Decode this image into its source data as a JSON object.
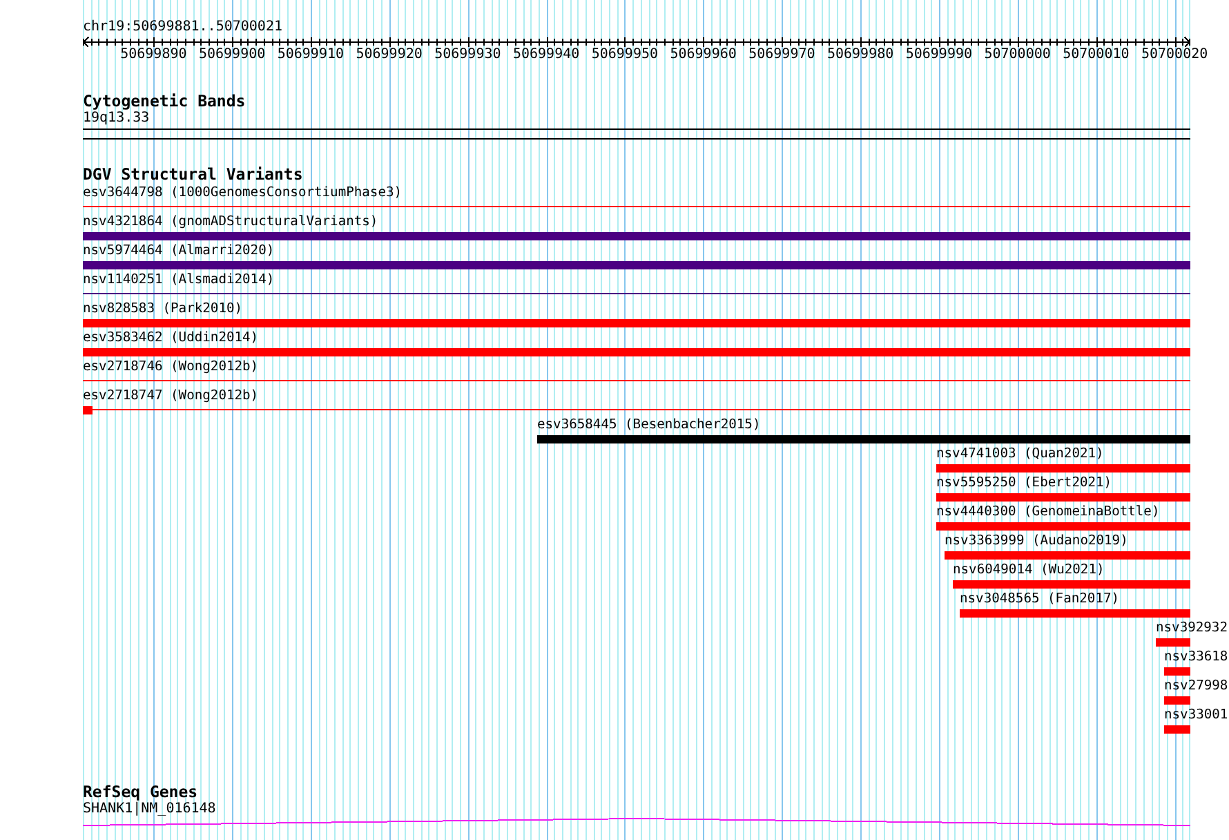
{
  "ruler": {
    "location": "chr19:50699881..50700021",
    "ticks": [
      "50699890",
      "50699900",
      "50699910",
      "50699920",
      "50699930",
      "50699940",
      "50699950",
      "50699960",
      "50699970",
      "50699980",
      "50699990",
      "50700000",
      "50700010",
      "50700020"
    ]
  },
  "tracks": [
    {
      "kind": "cytoband",
      "title": "Cytogenetic Bands",
      "bands": [
        {
          "label": "19q13.33"
        }
      ]
    },
    {
      "kind": "variants",
      "title": "DGV Structural Variants",
      "features": [
        {
          "label": "esv3644798 (1000GenomesConsortiumPhase3)",
          "kind": "thin",
          "color": "#ff0000"
        },
        {
          "label": "nsv4321864 (gnomADStructuralVariants)",
          "kind": "thick",
          "color": "#4b0082"
        },
        {
          "label": "nsv5974464 (Almarri2020)",
          "kind": "thick",
          "color": "#4b0082"
        },
        {
          "label": "nsv1140251 (Alsmadi2014)",
          "kind": "thin",
          "color": "#4b0082"
        },
        {
          "label": "nsv828583 (Park2010)",
          "kind": "thick",
          "color": "#ff0000"
        },
        {
          "label": "esv3583462 (Uddin2014)",
          "kind": "thick",
          "color": "#ff0000"
        },
        {
          "label": "esv2718746 (Wong2012b)",
          "kind": "thin",
          "color": "#ff0000"
        },
        {
          "label": "esv2718747 (Wong2012b)",
          "kind": "thin_start_block",
          "color": "#ff0000"
        },
        {
          "label": "esv3658445 (Besenbacher2015)",
          "kind": "thick",
          "color": "#000000"
        },
        {
          "label": "nsv4741003 (Quan2021)",
          "kind": "thick",
          "color": "#ff0000"
        },
        {
          "label": "nsv5595250 (Ebert2021)",
          "kind": "thick",
          "color": "#ff0000"
        },
        {
          "label": "nsv4440300 (GenomeinaBottle)",
          "kind": "thick",
          "color": "#ff0000"
        },
        {
          "label": "nsv3363999 (Audano2019)",
          "kind": "thick",
          "color": "#ff0000"
        },
        {
          "label": "nsv6049014 (Wu2021)",
          "kind": "thick",
          "color": "#ff0000"
        },
        {
          "label": "nsv3048565 (Fan2017)",
          "kind": "thick",
          "color": "#ff0000"
        },
        {
          "label": "nsv392932",
          "kind": "thick",
          "color": "#ff0000"
        },
        {
          "label": "nsv33618",
          "kind": "thick",
          "color": "#ff0000"
        },
        {
          "label": "nsv27998",
          "kind": "thick",
          "color": "#ff0000"
        },
        {
          "label": "nsv33001",
          "kind": "thick",
          "color": "#ff0000"
        }
      ]
    },
    {
      "kind": "genes",
      "title": "RefSeq Genes",
      "genes": [
        {
          "label": "SHANK1|NM_016148"
        }
      ]
    }
  ]
}
